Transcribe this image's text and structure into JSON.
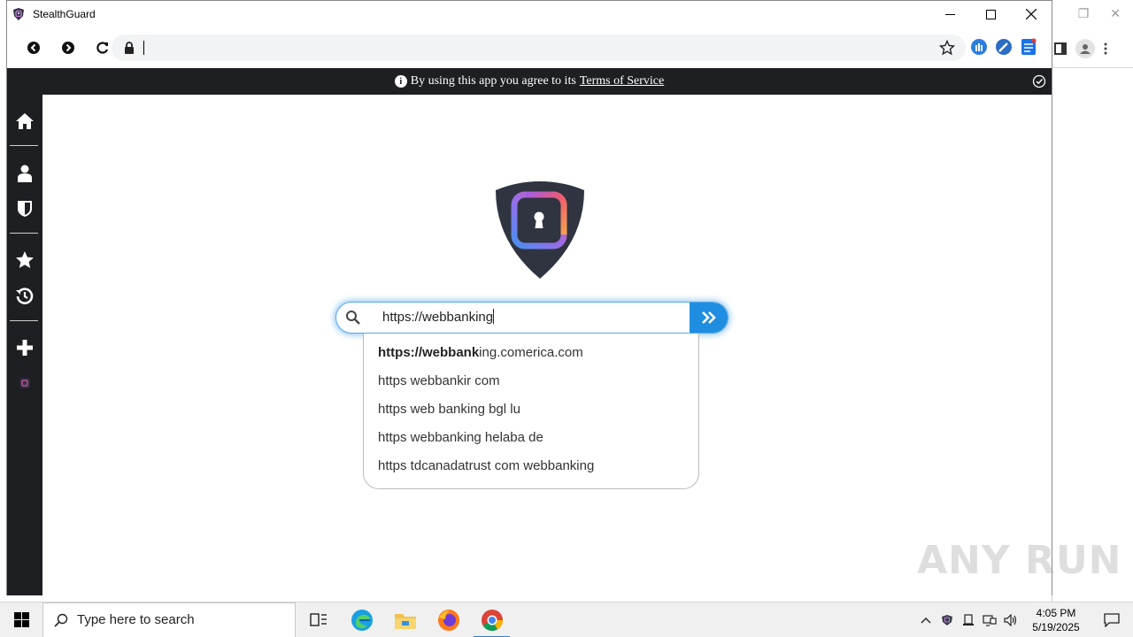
{
  "window": {
    "title": "StealthGuard"
  },
  "address_bar": {
    "value": ""
  },
  "tos_banner": {
    "prefix": "By using this app you agree to its",
    "link": "Terms of Service"
  },
  "sidebar": {
    "items": [
      {
        "icon": "home-icon"
      },
      {
        "icon": "user-icon"
      },
      {
        "icon": "shield-icon"
      },
      {
        "icon": "star-icon"
      },
      {
        "icon": "history-icon"
      },
      {
        "icon": "plus-icon"
      },
      {
        "icon": "stealthguard-mini-icon"
      }
    ]
  },
  "search": {
    "value": "https://webbanking"
  },
  "suggestions": [
    {
      "bold": "https://webbank",
      "rest": "ing.comerica.com"
    },
    {
      "bold": "",
      "rest": "https webbankir com"
    },
    {
      "bold": "",
      "rest": "https web banking bgl lu"
    },
    {
      "bold": "",
      "rest": "https webbanking helaba de"
    },
    {
      "bold": "",
      "rest": "https tdcanadatrust com webbanking"
    }
  ],
  "taskbar": {
    "search_placeholder": "Type here to search",
    "time": "4:05 PM",
    "date": "5/19/2025"
  },
  "watermark": "ANY RUN",
  "colors": {
    "banner_bg": "#1d1f22",
    "sidebar_bg": "#1d1f22",
    "accent": "#1f8ee0",
    "logo_shield": "#2f3440"
  }
}
